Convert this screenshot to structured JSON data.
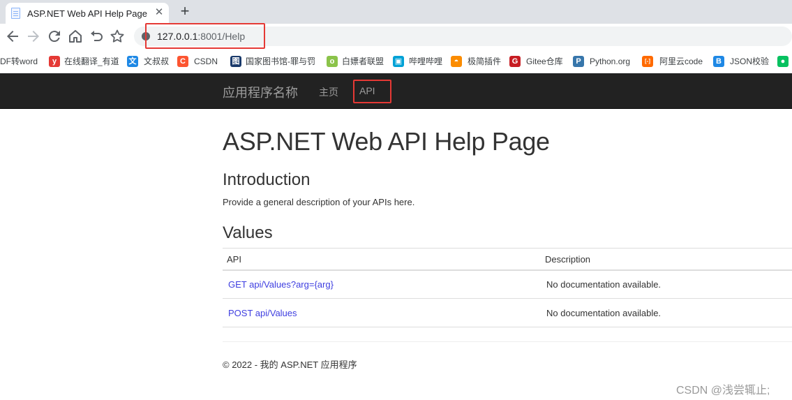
{
  "browser": {
    "tab": {
      "title": "ASP.NET Web API Help Page",
      "close": "✕"
    },
    "new_tab": "+",
    "address": {
      "host": "127.0.0.1",
      "rest": ":8001/Help"
    },
    "bookmarks": [
      {
        "label": "DF转word",
        "icon": "",
        "icon_name": "",
        "color": ""
      },
      {
        "label": "在线翻译_有道",
        "icon": "y",
        "icon_name": "youdao-icon",
        "color": "#e53935"
      },
      {
        "label": "文叔叔",
        "icon": "文",
        "icon_name": "wenshushu-icon",
        "color": "#1e88e5"
      },
      {
        "label": "CSDN",
        "icon": "C",
        "icon_name": "csdn-icon",
        "color": "#fc5531"
      },
      {
        "label": "国家图书馆-罪与罚",
        "icon": "图",
        "icon_name": "library-icon",
        "color": "#1a3a6b"
      },
      {
        "label": "白嫖者联盟",
        "icon": "o",
        "icon_name": "baipiao-icon",
        "color": "#8bc34a"
      },
      {
        "label": "哔哩哔哩",
        "icon": "▣",
        "icon_name": "bilibili-icon",
        "color": "#00a1d6"
      },
      {
        "label": "极简插件",
        "icon": "◓",
        "icon_name": "jijian-icon",
        "color": "#fb8c00"
      },
      {
        "label": "Gitee仓库",
        "icon": "G",
        "icon_name": "gitee-icon",
        "color": "#c71d23"
      },
      {
        "label": "Python.org",
        "icon": "P",
        "icon_name": "python-icon",
        "color": "#3776ab"
      },
      {
        "label": "阿里云code",
        "icon": "[-]",
        "icon_name": "aliyun-icon",
        "color": "#ff6a00"
      },
      {
        "label": "JSON校验",
        "icon": "B",
        "icon_name": "json-icon",
        "color": "#1e88e5"
      },
      {
        "label": "",
        "icon": "●",
        "icon_name": "wechat-icon",
        "color": "#07c160"
      }
    ]
  },
  "navbar": {
    "brand": "应用程序名称",
    "links": [
      "主页",
      "API"
    ]
  },
  "main": {
    "title": "ASP.NET Web API Help Page",
    "intro_heading": "Introduction",
    "intro_text": "Provide a general description of your APIs here.",
    "values_heading": "Values",
    "table": {
      "headers": [
        "API",
        "Description"
      ],
      "rows": [
        {
          "api": "GET api/Values?arg={arg}",
          "description": "No documentation available."
        },
        {
          "api": "POST api/Values",
          "description": "No documentation available."
        }
      ]
    },
    "footer": "© 2022 - 我的 ASP.NET 应用程序"
  },
  "watermark": "CSDN @浅尝辄止;",
  "colors": {
    "navbar": "#222222",
    "link": "#3e3ee0",
    "highlight": "#e53935"
  }
}
